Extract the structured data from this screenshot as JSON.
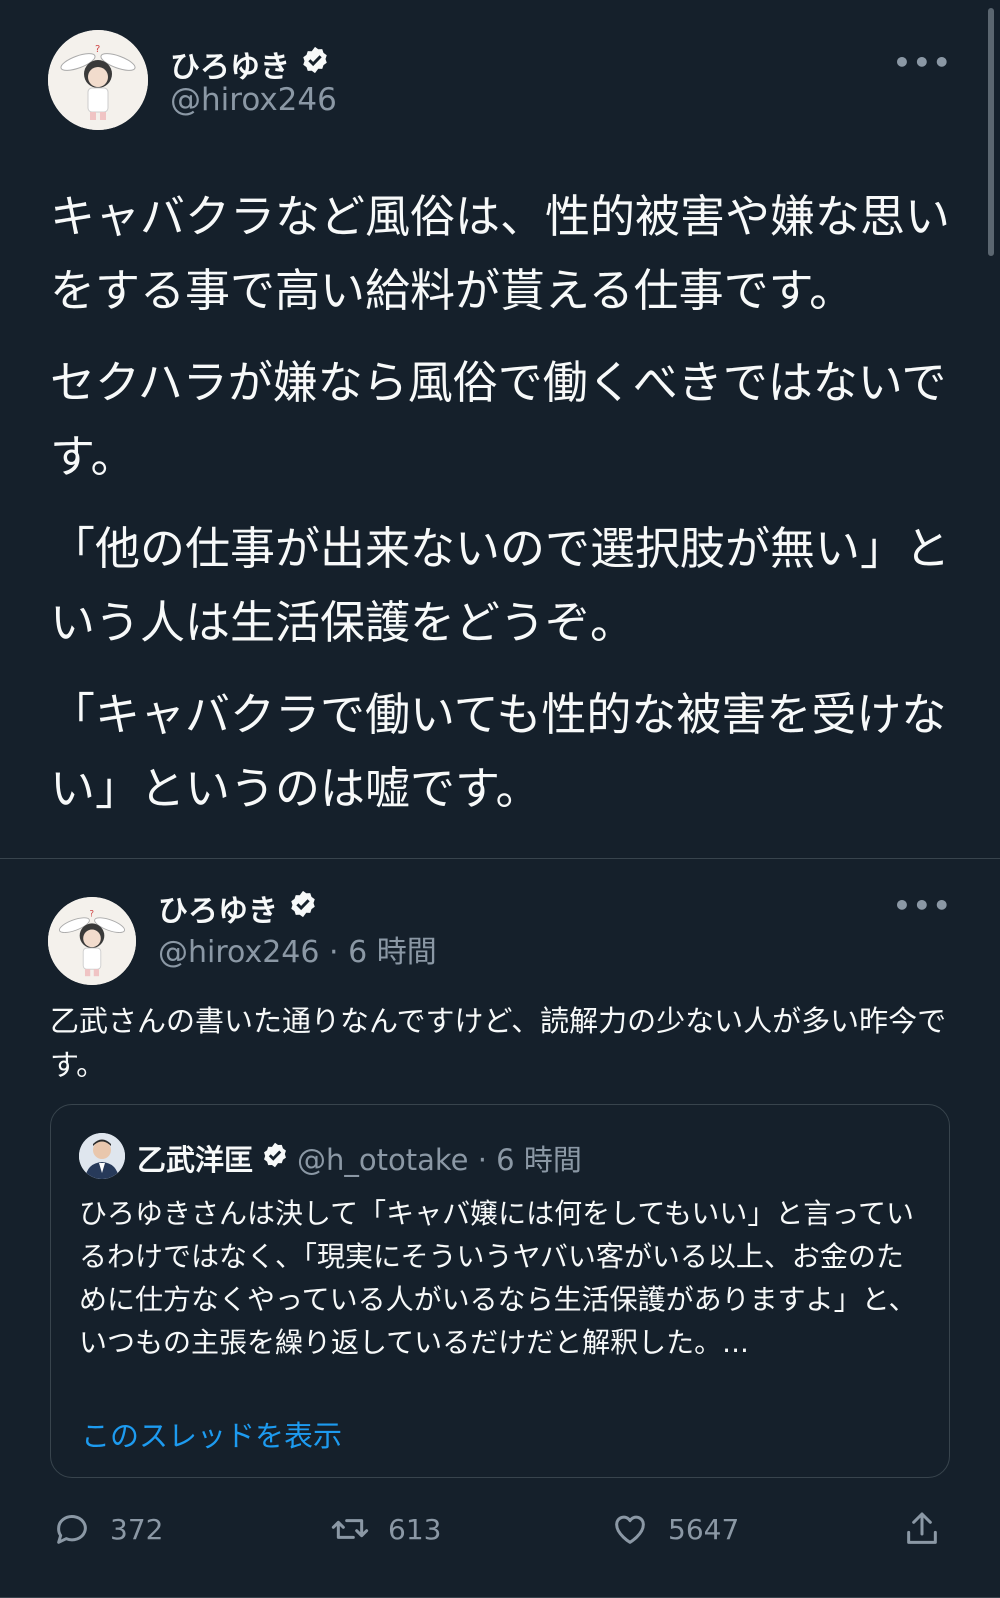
{
  "main_tweet": {
    "name": "ひろゆき",
    "handle": "@hirox246",
    "more": "•••",
    "paragraphs": [
      "キャバクラなど風俗は、性的被害や嫌な思いをする事で高い給料が貰える仕事です。",
      "セクハラが嫌なら風俗で働くべきではないです。",
      "「他の仕事が出来ないので選択肢が無い」という人は生活保護をどうぞ。",
      "「キャバクラで働いても性的な被害を受けない」というのは嘘です。"
    ]
  },
  "reply_tweet": {
    "name": "ひろゆき",
    "handle_time": "@hirox246 · 6 時間",
    "more": "•••",
    "text": "乙武さんの書いた通りなんですけど、読解力の少ない人が多い昨今です。",
    "quote": {
      "name": "乙武洋匡",
      "handle_time": "@h_ototake · 6 時間",
      "text": "ひろゆきさんは決して「キャバ嬢には何をしてもいい」と言っているわけではなく、「現実にそういうヤバい客がいる以上、お金のために仕方なくやっている人がいるなら生活保護がありますよ」と、いつもの主張を繰り返しているだけだと解釈した。...",
      "show_thread": "このスレッドを表示"
    },
    "actions": {
      "replies": "372",
      "retweets": "613",
      "likes": "5647"
    }
  },
  "colors": {
    "background": "#15202b",
    "text": "#f7f9f9",
    "secondary": "#8b98a5",
    "accent": "#1d9bf0",
    "border": "#38444d"
  },
  "icons": [
    "verified-badge-icon",
    "more-icon",
    "reply-icon",
    "retweet-icon",
    "like-icon",
    "share-icon"
  ]
}
